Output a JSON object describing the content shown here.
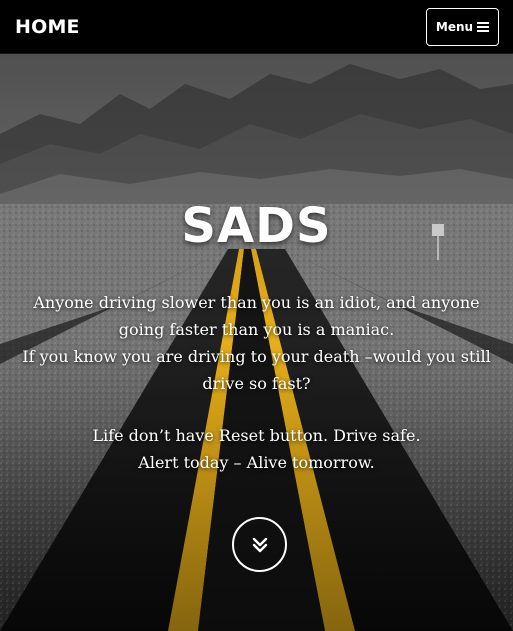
{
  "navbar": {
    "brand": "HOME",
    "menu_label": "Menu",
    "menu_icon": "bars-icon"
  },
  "hero": {
    "title": "SADS",
    "quote_lines_1": [
      "Anyone driving slower than you is an idiot, and anyone",
      "going faster than you is a maniac.",
      "If you know you are driving to your death –would you still",
      "drive so fast?"
    ],
    "quote_lines_2": [
      "Life don’t have Reset button. Drive safe.",
      "Alert today – Alive tomorrow."
    ],
    "scroll_icon": "chevron-double-down-icon"
  },
  "colors": {
    "navbar_bg": "#000000",
    "text": "#ffffff",
    "road_line": "#f2b71a"
  }
}
